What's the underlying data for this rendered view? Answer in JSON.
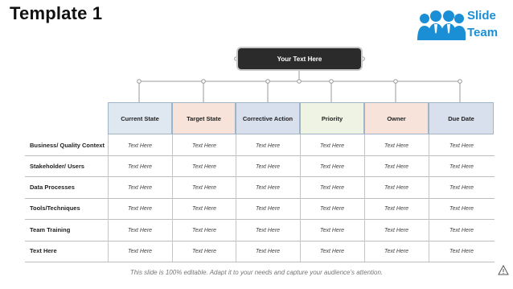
{
  "page": {
    "title": "Template 1",
    "footer_note": "This slide is 100% editable. Adapt it to your needs and capture your audience's attention."
  },
  "logo": {
    "line1": "Slide",
    "line2": "Team",
    "color": "#1a8fd6"
  },
  "top_box": {
    "label": "Your Text Here"
  },
  "table": {
    "columns": [
      {
        "label": "Current State",
        "color": "#dfe7f0"
      },
      {
        "label": "Target State",
        "color": "#f7e3d9"
      },
      {
        "label": "Corrective Action",
        "color": "#d8e0ee"
      },
      {
        "label": "Priority",
        "color": "#eef3e4"
      },
      {
        "label": "Owner",
        "color": "#f7e3d9"
      },
      {
        "label": "Due Date",
        "color": "#d8e0ee"
      }
    ],
    "rows": [
      {
        "label": "Business/ Quality Context",
        "cells": [
          "Text Here",
          "Text Here",
          "Text Here",
          "Text Here",
          "Text Here",
          "Text Here"
        ]
      },
      {
        "label": "Stakeholder/ Users",
        "cells": [
          "Text Here",
          "Text Here",
          "Text Here",
          "Text Here",
          "Text Here",
          "Text Here"
        ]
      },
      {
        "label": "Data Processes",
        "cells": [
          "Text Here",
          "Text Here",
          "Text Here",
          "Text Here",
          "Text Here",
          "Text Here"
        ]
      },
      {
        "label": "Tools/Techniques",
        "cells": [
          "Text Here",
          "Text Here",
          "Text Here",
          "Text Here",
          "Text Here",
          "Text Here"
        ]
      },
      {
        "label": "Team Training",
        "cells": [
          "Text Here",
          "Text Here",
          "Text Here",
          "Text Here",
          "Text Here",
          "Text Here"
        ]
      },
      {
        "label": "Text Here",
        "cells": [
          "Text Here",
          "Text Here",
          "Text Here",
          "Text Here",
          "Text Here",
          "Text Here"
        ]
      }
    ]
  }
}
